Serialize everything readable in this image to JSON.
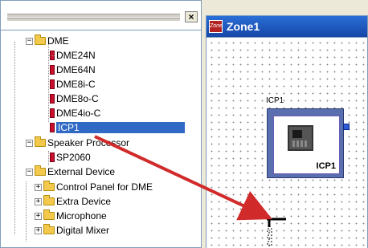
{
  "tree_panel": {
    "close_label": "×",
    "items": [
      {
        "label": "DME",
        "expander": "−",
        "kind": "folder"
      },
      {
        "label": "DME24N",
        "kind": "device"
      },
      {
        "label": "DME64N",
        "kind": "device"
      },
      {
        "label": "DME8i-C",
        "kind": "device"
      },
      {
        "label": "DME8o-C",
        "kind": "device"
      },
      {
        "label": "DME4io-C",
        "kind": "device"
      },
      {
        "label": "ICP1",
        "kind": "device",
        "selected": true
      },
      {
        "label": "Speaker Processor",
        "expander": "−",
        "kind": "folder"
      },
      {
        "label": "SP2060",
        "kind": "device"
      },
      {
        "label": "External Device",
        "expander": "−",
        "kind": "folder"
      },
      {
        "label": "Control Panel for DME",
        "expander": "+",
        "kind": "folder"
      },
      {
        "label": "Extra Device",
        "expander": "+",
        "kind": "folder"
      },
      {
        "label": "Microphone",
        "expander": "+",
        "kind": "folder"
      },
      {
        "label": "Digital Mixer",
        "expander": "+",
        "kind": "folder"
      }
    ]
  },
  "zone_window": {
    "icon_text": "Zone",
    "title": "Zone1",
    "component": {
      "label": "ICP1",
      "name": "ICP1"
    }
  },
  "colors": {
    "selection": "#316ac5",
    "titlebar": "#1f5bc9",
    "component_frame": "#5a6fae",
    "drag_arrow": "#d12a2a",
    "dme_icon": "#c8102e",
    "folder": "#f2c94c"
  },
  "icons": {
    "folder": "folder-icon",
    "device": "dme-device-icon",
    "zone": "zone-icon",
    "close": "close-icon"
  }
}
